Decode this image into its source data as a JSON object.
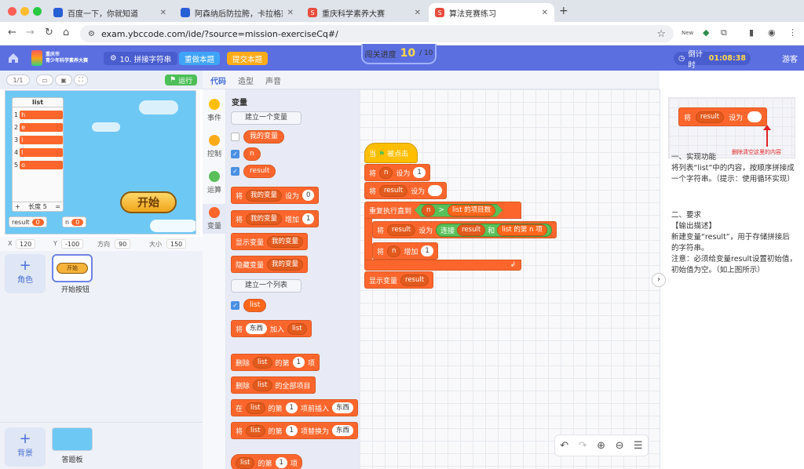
{
  "browser": {
    "tabs": [
      {
        "title": "百度一下，你就知道",
        "fav_color": "#2b5cd9",
        "fav_glyph": "🐾"
      },
      {
        "title": "阿森纳后防拉胯，卡拉格怒批萨",
        "fav_color": "#2b5cd9",
        "fav_glyph": "🐾"
      },
      {
        "title": "重庆科学素养大赛",
        "fav_color": "#e74c3c",
        "fav_glyph": "S"
      },
      {
        "title": "算法竞赛练习",
        "fav_color": "#e74c3c",
        "fav_glyph": "S"
      }
    ],
    "url": "exam.ybccode.com/ide/?source=mission-exerciseCq#/",
    "new_badge": "New"
  },
  "header": {
    "logo_line1": "重庆市",
    "logo_line2": "青少年科学素养大赛",
    "problem": "10. 拼接字符串",
    "redo_label": "重做本题",
    "submit_label": "提交本题",
    "progress_label": "闯关进度",
    "progress_current": "10",
    "progress_total": "/ 10",
    "timer_label": "倒计时",
    "timer_value": "01:08:38",
    "guest_label": "游客"
  },
  "stage": {
    "sprite_count": "1",
    "sprite_count_total": "/1",
    "run_label": "运行",
    "list_title": "list",
    "list_items": [
      "h",
      "e",
      "l",
      "l",
      "o"
    ],
    "list_length_label": "长度 5",
    "list_plus": "+",
    "list_eq": "=",
    "start_button": "开始",
    "var_result_label": "result",
    "var_result_value": "0",
    "var_n_label": "n",
    "var_n_value": "0"
  },
  "props": {
    "x_label": "X",
    "x_value": "120",
    "y_label": "Y",
    "y_value": "-100",
    "dir_label": "方向",
    "dir_value": "90",
    "size_label": "大小",
    "size_value": "150"
  },
  "sprites": {
    "add_label": "角色",
    "card_mini": "开始",
    "card_label": "开始按钮",
    "bg_label": "背景",
    "board_label": "答题板"
  },
  "editor": {
    "tabs": [
      "代码",
      "造型",
      "声音"
    ],
    "categories": [
      {
        "label": "事件",
        "color": "#ffbf00"
      },
      {
        "label": "控制",
        "color": "#ffab19"
      },
      {
        "label": "运算",
        "color": "#59c059"
      },
      {
        "label": "变量",
        "color": "#fc662c"
      }
    ],
    "palette": {
      "title": "变量",
      "make_var": "建立一个变量",
      "vars": [
        "我的变量",
        "n",
        "result"
      ],
      "set_block": {
        "a": "将",
        "b": "我的变量",
        "c": "设为",
        "d": "0"
      },
      "change_block": {
        "a": "将",
        "b": "我的变量",
        "c": "增加",
        "d": "1"
      },
      "show_block": {
        "a": "显示变量",
        "b": "我的变量"
      },
      "hide_block": {
        "a": "隐藏变量",
        "b": "我的变量"
      },
      "make_list": "建立一个列表",
      "list_name": "list",
      "add_block": {
        "a": "将",
        "b": "东西",
        "c": "加入",
        "d": "list"
      },
      "del_block": {
        "a": "删除",
        "b": "list",
        "c": "的第",
        "d": "1",
        "e": "项"
      },
      "delall_block": {
        "a": "删除",
        "b": "list",
        "c": "的全部项目"
      },
      "insert_block": {
        "a": "在",
        "b": "list",
        "c": "的第",
        "d": "1",
        "e": "项前插入",
        "f": "东西"
      },
      "replace_block": {
        "a": "将",
        "b": "list",
        "c": "的第",
        "d": "1",
        "e": "项替换为",
        "f": "东西"
      },
      "item_block": {
        "a": "list",
        "b": "的第",
        "c": "1",
        "d": "项"
      }
    },
    "script": {
      "hat_a": "当",
      "hat_b": "被点击",
      "set_n": {
        "a": "将",
        "b": "n",
        "c": "设为",
        "d": "1"
      },
      "set_result": {
        "a": "将",
        "b": "result",
        "c": "设为"
      },
      "repeat": {
        "a": "重复执行直到",
        "b": "n",
        "c": ">",
        "d": "list",
        "e": "的项目数"
      },
      "inner1": {
        "a": "将",
        "b": "result",
        "c": "设为",
        "d": "连接",
        "e": "result",
        "f": "和",
        "g": "list",
        "h": "的第",
        "i": "n",
        "j": "项"
      },
      "inner2": {
        "a": "将",
        "b": "n",
        "c": "增加",
        "d": "1"
      },
      "show": {
        "a": "显示变量",
        "b": "result"
      }
    }
  },
  "problem": {
    "example_a": "将",
    "example_b": "result",
    "example_c": "设为",
    "example_note": "删除清空这里的内容",
    "s1_title": "一、实现功能",
    "s1_body": "将列表“list”中的内容，按顺序拼接成一个字符串。（提示：使用循环实现）",
    "s2_title": "二、要求",
    "s2_sub": "【输出描述】",
    "s2_body": "新建变量“result”，用于存储拼接后的字符串。",
    "s2_note": "注意：必须给变量result设置初始值，初始值为空。（如上图所示）"
  }
}
